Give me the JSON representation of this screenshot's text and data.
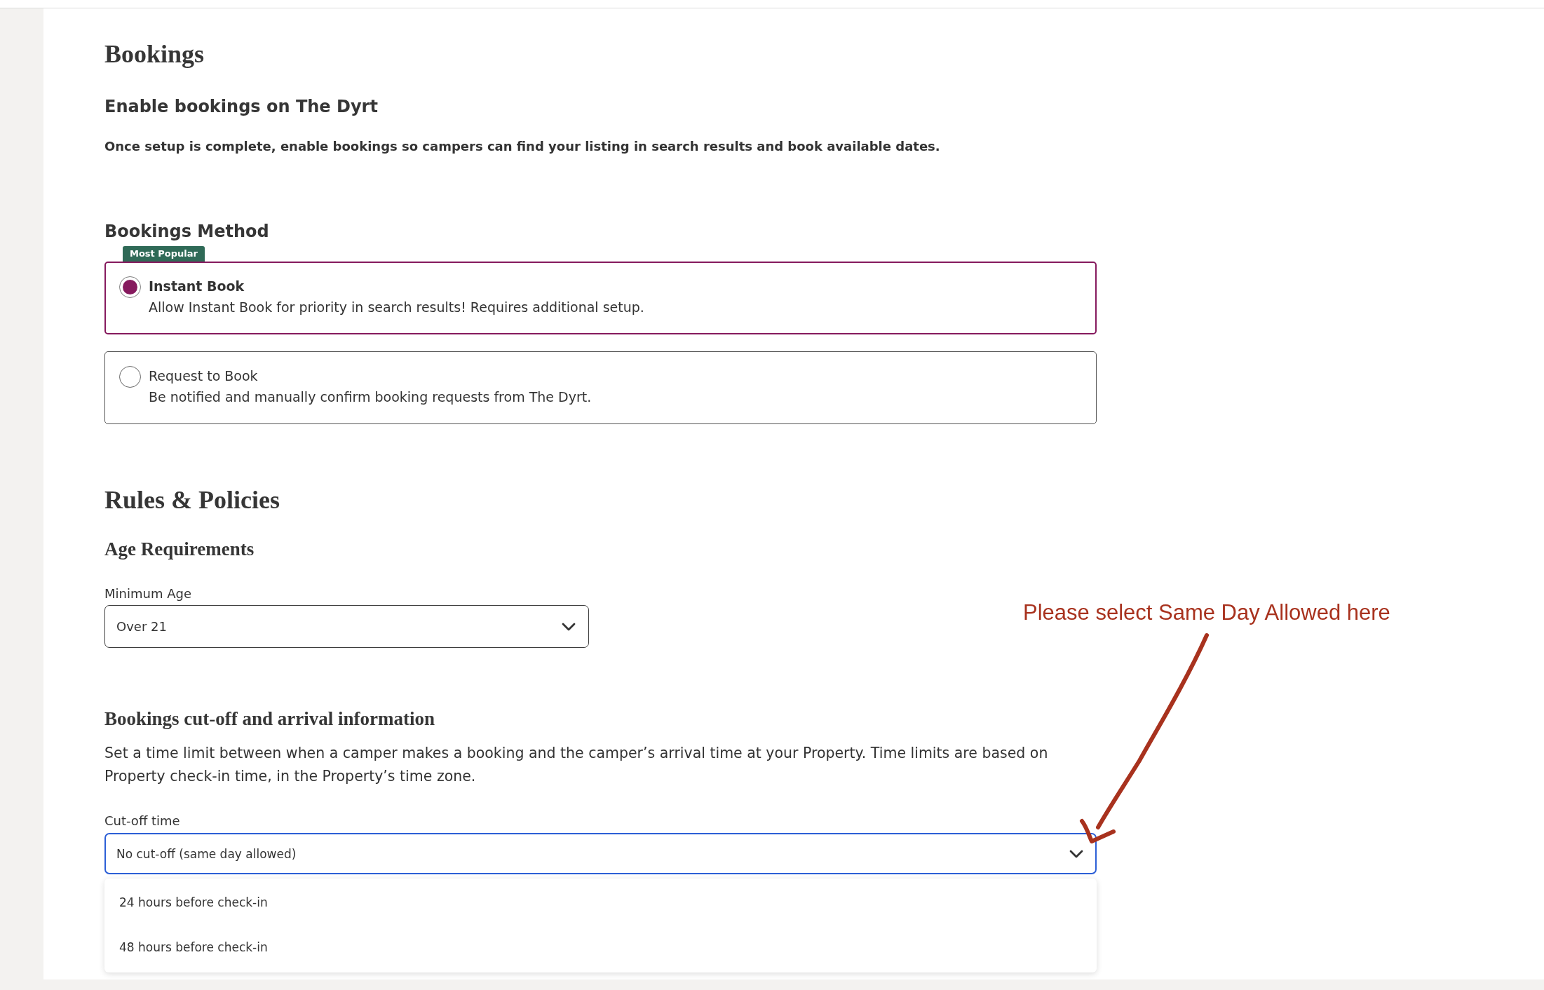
{
  "bookings": {
    "title": "Bookings",
    "subtitle": "Enable bookings on The Dyrt",
    "description": "Once setup is complete, enable bookings so campers can find your listing in search results and book available dates."
  },
  "bookings_method": {
    "title": "Bookings Method",
    "options": [
      {
        "label": "Instant Book",
        "description": "Allow Instant Book for priority in search results! Requires additional setup.",
        "badge": "Most Popular",
        "selected": true
      },
      {
        "label": "Request to Book",
        "description": "Be notified and manually confirm booking requests from The Dyrt.",
        "selected": false
      }
    ]
  },
  "rules_policies": {
    "title": "Rules & Policies",
    "age_requirements": {
      "title": "Age Requirements",
      "minimum_age": {
        "label": "Minimum Age",
        "value": "Over 21"
      }
    },
    "cutoff": {
      "title": "Bookings cut-off and arrival information",
      "description": "Set a time limit between when a camper makes a booking and the camper’s arrival time at your Property. Time limits are based on Property check-in time, in the Property’s time zone.",
      "cutoff_time": {
        "label": "Cut-off time",
        "value": "No cut-off (same day allowed)",
        "expanded": true,
        "options": [
          {
            "label": "24 hours before check-in",
            "selected": false
          },
          {
            "label": "48 hours before check-in",
            "selected": false
          }
        ]
      }
    }
  },
  "annotation": {
    "text": "Please select Same Day Allowed here"
  }
}
